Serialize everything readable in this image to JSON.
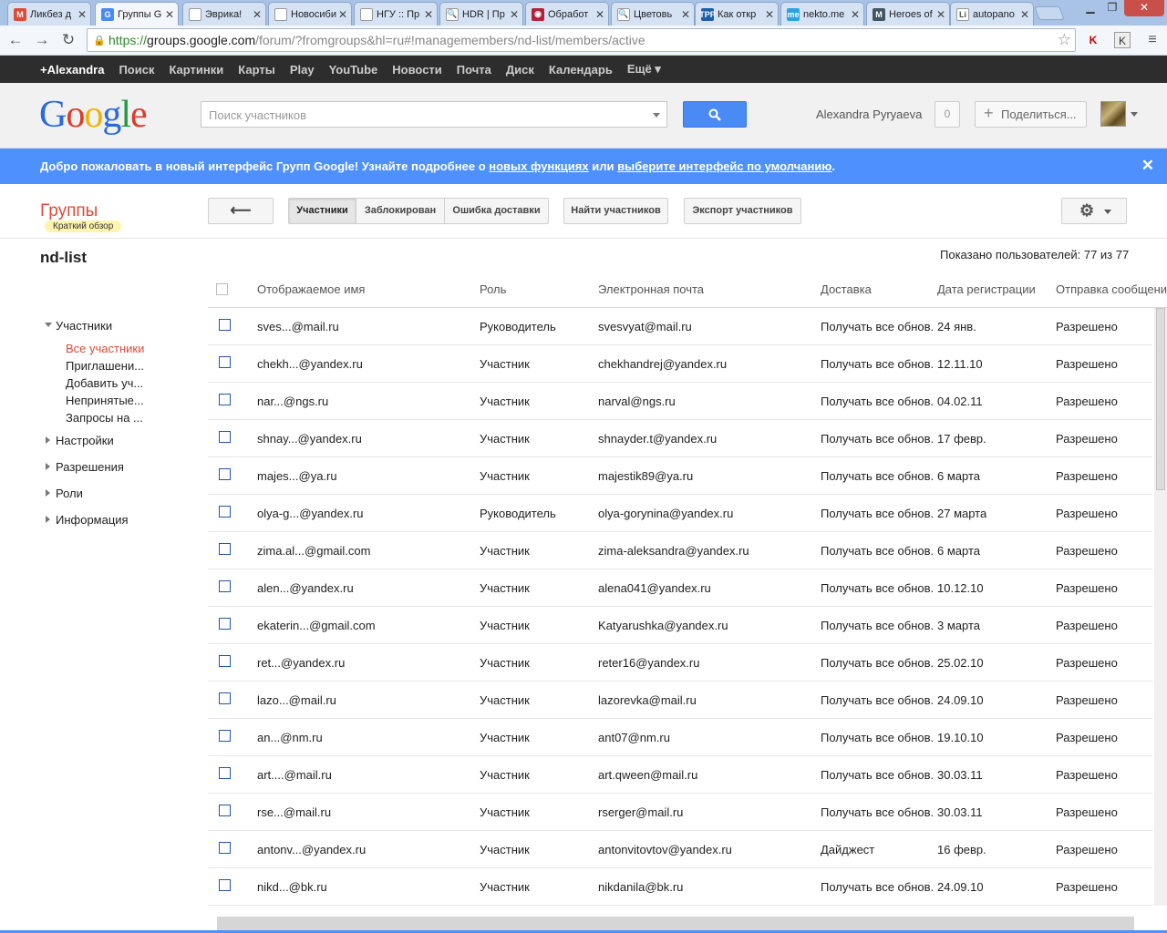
{
  "browser": {
    "tabs": [
      {
        "title": "Ликбез д",
        "icon": "gmail-icon",
        "color": "#dd4b39",
        "glyph": "M"
      },
      {
        "title": "Группы G",
        "icon": "groups-icon",
        "color": "#4a8af4",
        "glyph": "G",
        "active": true
      },
      {
        "title": "Эврика!",
        "icon": "page-icon",
        "color": "#ffffff",
        "glyph": ""
      },
      {
        "title": "Новосиби",
        "icon": "page-icon",
        "color": "#ffffff",
        "glyph": ""
      },
      {
        "title": "НГУ :: Пр",
        "icon": "page-icon",
        "color": "#ffffff",
        "glyph": ""
      },
      {
        "title": "HDR | Пр",
        "icon": "magnifier-icon",
        "color": "#ffffff",
        "glyph": "🔍"
      },
      {
        "title": "Обработ",
        "icon": "camera-icon",
        "color": "#b5203a",
        "glyph": "◉"
      },
      {
        "title": "Цветовь",
        "icon": "magnifier-icon",
        "color": "#ffffff",
        "glyph": "🔍"
      },
      {
        "title": "Как откр",
        "icon": "tpp-icon",
        "color": "#1c5fa8",
        "glyph": "TPP"
      },
      {
        "title": "nekto.me",
        "icon": "me-icon",
        "color": "#2aa4e0",
        "glyph": "me"
      },
      {
        "title": "Heroes of",
        "icon": "max-icon",
        "color": "#445566",
        "glyph": "M"
      },
      {
        "title": "autopano",
        "icon": "li-icon",
        "color": "#ffffff",
        "glyph": "Li"
      }
    ],
    "url": {
      "scheme": "https://",
      "host": "groups.google.com",
      "path": "/forum/?fromgroups&hl=ru#!managemembers/nd-list/members/active"
    }
  },
  "gbar": {
    "items": [
      "+Alexandra",
      "Поиск",
      "Картинки",
      "Карты",
      "Play",
      "YouTube",
      "Новости",
      "Почта",
      "Диск",
      "Календарь",
      "Ещё ▾"
    ]
  },
  "header": {
    "logo": "Google",
    "search_placeholder": "Поиск участников",
    "user_name": "Alexandra Pyryaeva",
    "notifications": "0",
    "share_label": "Поделиться..."
  },
  "banner": {
    "text1": "Добро пожаловать в новый интерфейс Групп Google! Узнайте подробнее о ",
    "link1": "новых функциях",
    "text2": " или ",
    "link2": "выберите интерфейс по умолчанию",
    "text3": "."
  },
  "toolbar": {
    "groups_title": "Группы",
    "overview": "Краткий обзор",
    "back": "⟵",
    "tab_members": "Участники",
    "tab_blocked": "Заблокирован",
    "tab_bounce": "Ошибка доставки",
    "find_members": "Найти участников",
    "export_members": "Экспорт участников"
  },
  "group": {
    "name": "nd-list",
    "shown": "Показано пользователей: 77 из 77"
  },
  "leftnav": {
    "members": "Участники",
    "sub": [
      "Все участники",
      "Приглашени...",
      "Добавить уч...",
      "Непринятые...",
      "Запросы на ..."
    ],
    "settings": "Настройки",
    "permissions": "Разрешения",
    "roles": "Роли",
    "info": "Информация"
  },
  "table": {
    "columns": [
      "Отображаемое имя",
      "Роль",
      "Электронная почта",
      "Доставка",
      "Дата регистрации",
      "Отправка сообщени"
    ],
    "rows": [
      [
        "sves...@mail.ru",
        "Руководитель",
        "svesvyat@mail.ru",
        "Получать все обнов.",
        "24 янв.",
        "Разрешено"
      ],
      [
        "chekh...@yandex.ru",
        "Участник",
        "chekhandrej@yandex.ru",
        "Получать все обнов.",
        "12.11.10",
        "Разрешено"
      ],
      [
        "nar...@ngs.ru",
        "Участник",
        "narval@ngs.ru",
        "Получать все обнов.",
        "04.02.11",
        "Разрешено"
      ],
      [
        "shnay...@yandex.ru",
        "Участник",
        "shnayder.t@yandex.ru",
        "Получать все обнов.",
        "17 февр.",
        "Разрешено"
      ],
      [
        "majes...@ya.ru",
        "Участник",
        "majestik89@ya.ru",
        "Получать все обнов.",
        "6 марта",
        "Разрешено"
      ],
      [
        "olya-g...@yandex.ru",
        "Руководитель",
        "olya-gorynina@yandex.ru",
        "Получать все обнов.",
        "27 марта",
        "Разрешено"
      ],
      [
        "zima.al...@gmail.com",
        "Участник",
        "zima-aleksandra@yandex.ru",
        "Получать все обнов.",
        "6 марта",
        "Разрешено"
      ],
      [
        "alen...@yandex.ru",
        "Участник",
        "alena041@yandex.ru",
        "Получать все обнов.",
        "10.12.10",
        "Разрешено"
      ],
      [
        "ekaterin...@gmail.com",
        "Участник",
        "Katyarushka@yandex.ru",
        "Получать все обнов.",
        "3 марта",
        "Разрешено"
      ],
      [
        "ret...@yandex.ru",
        "Участник",
        "reter16@yandex.ru",
        "Получать все обнов.",
        "25.02.10",
        "Разрешено"
      ],
      [
        "lazo...@mail.ru",
        "Участник",
        "lazorevka@mail.ru",
        "Получать все обнов.",
        "24.09.10",
        "Разрешено"
      ],
      [
        "an...@nm.ru",
        "Участник",
        "ant07@nm.ru",
        "Получать все обнов.",
        "19.10.10",
        "Разрешено"
      ],
      [
        "art....@mail.ru",
        "Участник",
        "art.qween@mail.ru",
        "Получать все обнов.",
        "30.03.11",
        "Разрешено"
      ],
      [
        "rse...@mail.ru",
        "Участник",
        "rserger@mail.ru",
        "Получать все обнов.",
        "30.03.11",
        "Разрешено"
      ],
      [
        "antonv...@yandex.ru",
        "Участник",
        "antonvitovtov@yandex.ru",
        "Дайджест",
        "16 февр.",
        "Разрешено"
      ],
      [
        "nikd...@bk.ru",
        "Участник",
        "nikdanila@bk.ru",
        "Получать все обнов.",
        "24.09.10",
        "Разрешено"
      ]
    ]
  }
}
